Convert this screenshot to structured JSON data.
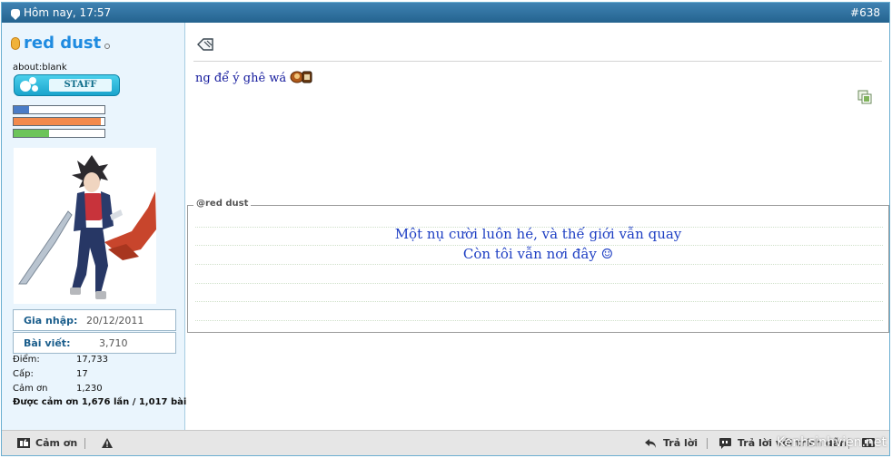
{
  "header": {
    "date": "Hôm nay, 17:57",
    "post_number": "#638"
  },
  "user": {
    "name": "red dust",
    "title": "about:blank",
    "rank": "STAFF",
    "bars": [
      {
        "name": "bar-1",
        "fill": 0.17,
        "color": "#4a7cc7"
      },
      {
        "name": "bar-2",
        "fill": 0.96,
        "color": "#f28a4c"
      },
      {
        "name": "bar-3",
        "fill": 0.39,
        "color": "#6cc45a"
      }
    ],
    "join_label": "Gia nhập:",
    "join_date": "20/12/2011",
    "posts_label": "Bài viết:",
    "posts_value": "3,710",
    "points_label": "Điểm:",
    "points_value": "17,733",
    "level_label": "Cấp:",
    "level_value": "17",
    "thanks_label": "Cảm ơn",
    "thanks_value": "1,230",
    "thanked_summary": "Được cảm ơn 1,676 lần / 1,017 bài"
  },
  "post": {
    "message": "ng để ý ghê wá",
    "signature_legend": "@red dust",
    "signature_line1": "Một nụ cười luôn hé, và thế giới vẫn quay",
    "signature_line2": "Còn tôi vẫn nơi đây ☺"
  },
  "footer": {
    "thanks_button": "Cảm ơn",
    "reply_button": "Trả lời",
    "reply_quote_button": "Trả lời với trích dẫn"
  },
  "watermark": "Kenhsinhvien.net"
}
